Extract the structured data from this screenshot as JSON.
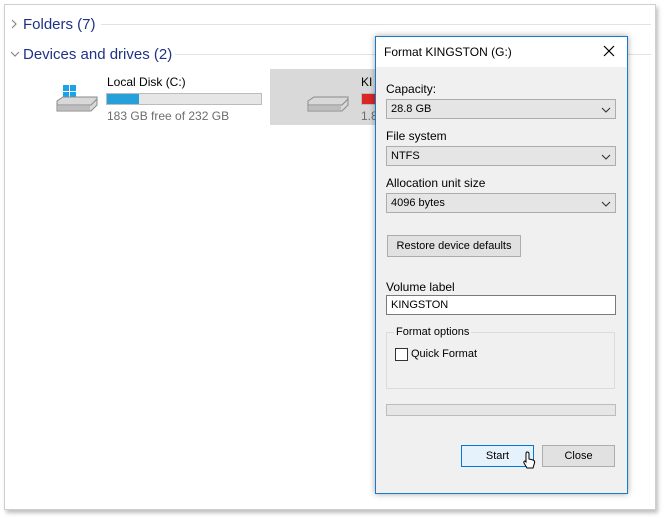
{
  "explorer": {
    "folders_group": "Folders (7)",
    "devices_group": "Devices and drives (2)",
    "drives": [
      {
        "name": "Local Disk (C:)",
        "free_text": "183 GB free of 232 GB",
        "used_fraction": 0.21,
        "bar_color": "#26a0da",
        "icon": "windows-drive-icon"
      },
      {
        "name": "KI",
        "free_text": "1.8",
        "used_fraction": 0.94,
        "bar_color": "#da2626",
        "icon": "usb-drive-icon"
      }
    ]
  },
  "dialog": {
    "title": "Format KINGSTON (G:)",
    "capacity_label": "Capacity:",
    "capacity_value": "28.8 GB",
    "filesystem_label": "File system",
    "filesystem_value": "NTFS",
    "alloc_label": "Allocation unit size",
    "alloc_value": "4096 bytes",
    "restore_button": "Restore device defaults",
    "volume_label": "Volume label",
    "volume_value": "KINGSTON",
    "format_options_label": "Format options",
    "quick_format_label": "Quick Format",
    "quick_format_checked": false,
    "progress": 0,
    "start_button": "Start",
    "close_button": "Close"
  },
  "colors": {
    "accent": "#0078d7",
    "group_text": "#1e3287",
    "drive_bar_normal": "#26a0da",
    "drive_bar_full": "#da2626"
  }
}
